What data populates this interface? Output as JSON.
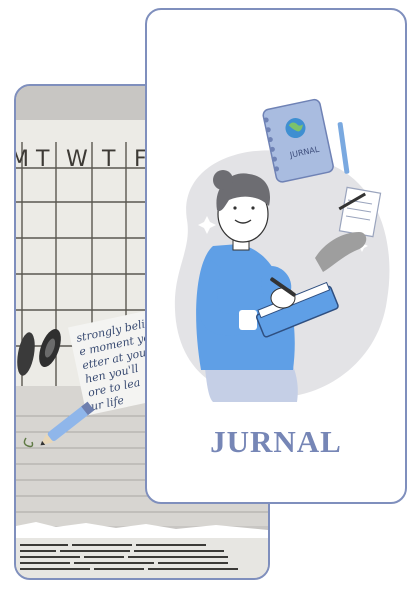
{
  "calendar": {
    "weekdays": [
      "M",
      "T",
      "W",
      "T",
      "F"
    ]
  },
  "note": {
    "lines": [
      "strongly beli",
      "e moment you",
      "etter at you",
      "hen you'll",
      "ore to lea",
      "ur life"
    ]
  },
  "notebook_cover": {
    "label": "JURNAL"
  },
  "cover": {
    "title": "JURNAL"
  },
  "colors": {
    "accent": "#7686b6",
    "card_border": "#7f8fbd",
    "shirt": "#5f9fe6",
    "blob": "#e3e3e6"
  }
}
